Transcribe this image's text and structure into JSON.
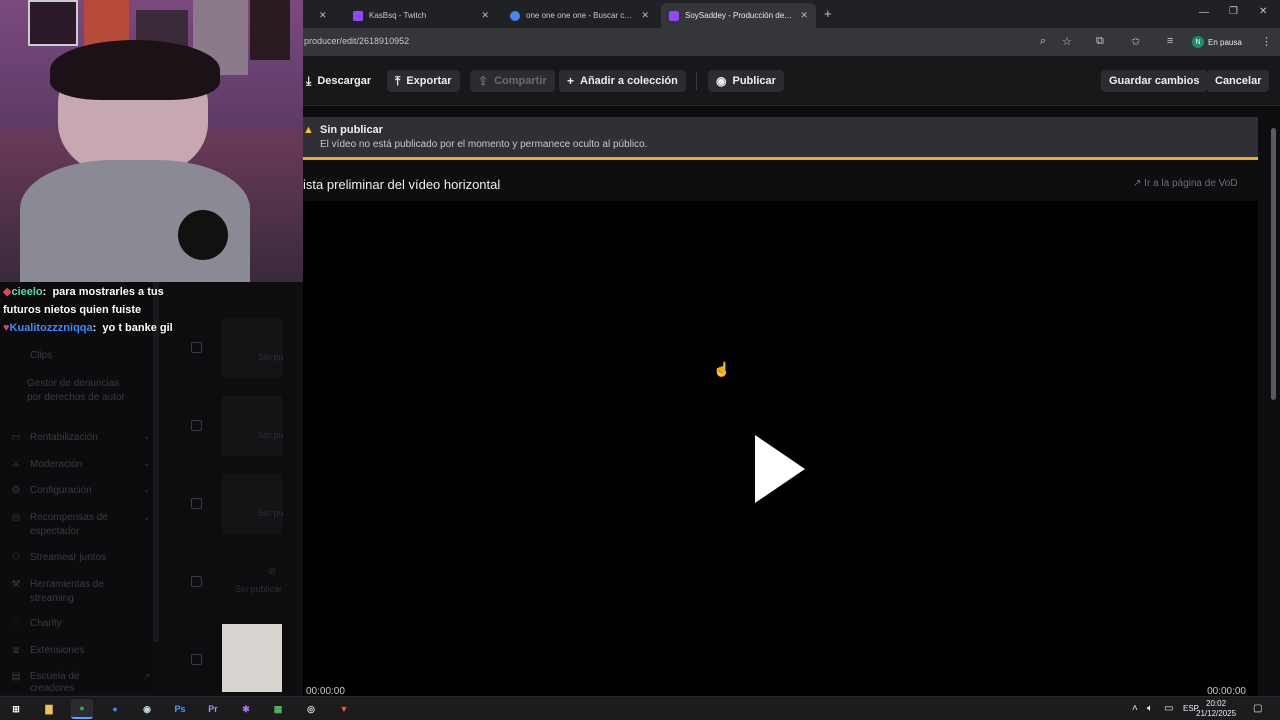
{
  "browser": {
    "tabs": [
      {
        "label": "",
        "favicon_color": "#9146ff",
        "close": "✕"
      },
      {
        "label": "KasBsq - Twitch",
        "favicon_color": "#9146ff",
        "close": "✕"
      },
      {
        "label": "one one one one - Buscar con G",
        "favicon_color": "#4285f4",
        "close": "✕"
      },
      {
        "label": "SoySaddey - Producción de vídeo",
        "favicon_color": "#9146ff",
        "close": "✕"
      }
    ],
    "new_tab": "+",
    "url": "producer/edit/2618910952",
    "profile_initial": "N",
    "profile_status": "En pausa"
  },
  "toolbar": {
    "download": "Descargar",
    "export": "Exportar",
    "share": "Compartir",
    "add_collection": "Añadir a colección",
    "publish": "Publicar",
    "save": "Guardar cambios",
    "cancel": "Cancelar"
  },
  "warning": {
    "title": "Sin publicar",
    "text": "El vídeo no está publicado por el momento y permanece oculto al público."
  },
  "preview": {
    "title": "ista preliminar del vídeo horizontal",
    "vod_link": "Ir a la página de VoD",
    "time_start": "00:00:00",
    "time_end": "00:00:00"
  },
  "sidebar": {
    "items": [
      {
        "label": "Clips",
        "icon": "clip-icon",
        "chevron": false
      },
      {
        "label": "Gestor de denuncias por derechos de autor",
        "icon": "",
        "chevron": false
      },
      {
        "label": "Rentabilización",
        "icon": "money-icon",
        "chevron": true
      },
      {
        "label": "Moderación",
        "icon": "sword-icon",
        "chevron": true
      },
      {
        "label": "Configuración",
        "icon": "gear-icon",
        "chevron": true
      },
      {
        "label": "Recompensas de espectador",
        "icon": "reward-icon",
        "chevron": true
      },
      {
        "label": "Streamear juntos",
        "icon": "people-icon",
        "chevron": false
      },
      {
        "label": "Herramientas de streaming",
        "icon": "tools-icon",
        "chevron": false
      },
      {
        "label": "Charity",
        "icon": "heart-icon",
        "chevron": false
      },
      {
        "label": "Extensiones",
        "icon": "puzzle-icon",
        "chevron": false
      },
      {
        "label": "Escuela de creadores",
        "icon": "book-icon",
        "chevron": false
      }
    ]
  },
  "clips": {
    "labels": [
      "Sin pu",
      "Sin pu",
      "Sin pu",
      "Sin publicar",
      ""
    ]
  },
  "chat": [
    {
      "user": "cieelo",
      "user_color": "#4fe0b0",
      "badge_color": "#e0455b",
      "message": "para mostrarles a tus futuros nietos quien fuiste"
    },
    {
      "user": "Kualitozzzniqqa",
      "user_color": "#3c8dff",
      "badge_color": "#e0455b",
      "message": "yo t banke gil"
    }
  ],
  "taskbar": {
    "language": "ESP",
    "time": "20:02",
    "date": "21/12/2025",
    "apps": [
      {
        "name": "windows-start",
        "label": "⊞",
        "color": "#1c1c1f"
      },
      {
        "name": "file-explorer",
        "label": "▇",
        "color": "#1c1c1f"
      },
      {
        "name": "chrome",
        "label": "●",
        "color": "#2c2c30"
      },
      {
        "name": "chrome-profile",
        "label": "●",
        "color": "#1c1c1f"
      },
      {
        "name": "steam",
        "label": "◉",
        "color": "#1c1c1f"
      },
      {
        "name": "photoshop",
        "label": "Ps",
        "color": "#1c1c1f"
      },
      {
        "name": "premiere",
        "label": "Pr",
        "color": "#1c1c1f"
      },
      {
        "name": "app-purple",
        "label": "✱",
        "color": "#1c1c1f"
      },
      {
        "name": "minecraft",
        "label": "▦",
        "color": "#1c1c1f"
      },
      {
        "name": "obs",
        "label": "◎",
        "color": "#1c1c1f"
      },
      {
        "name": "brave",
        "label": "▼",
        "color": "#1c1c1f"
      }
    ]
  },
  "colors": {
    "accent_warning": "#e5b32a",
    "twitch_purple": "#9146ff"
  }
}
